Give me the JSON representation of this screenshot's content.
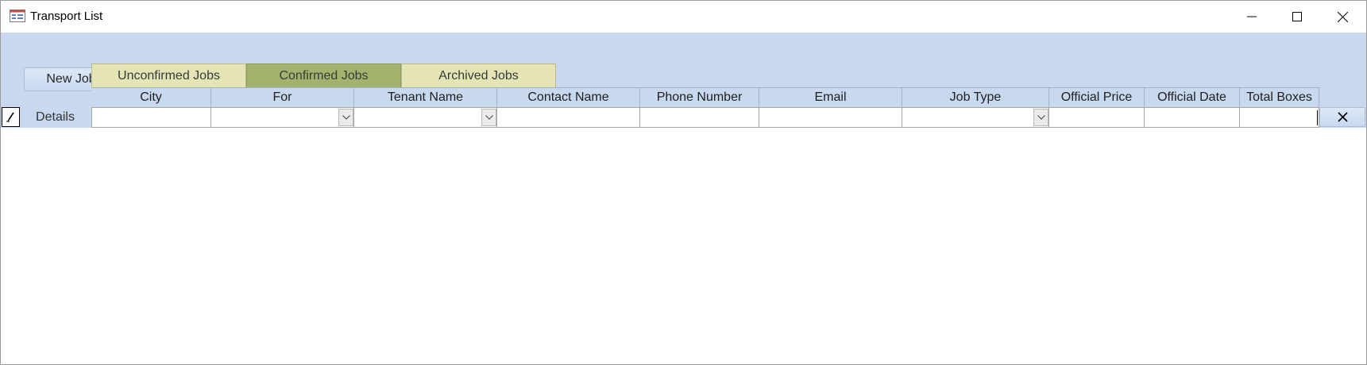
{
  "window": {
    "title": "Transport List"
  },
  "header": {
    "new_job_label": "New Job"
  },
  "tabs": [
    {
      "label": "Unconfirmed Jobs",
      "active": false
    },
    {
      "label": "Confirmed Jobs",
      "active": true
    },
    {
      "label": "Archived Jobs",
      "active": false
    }
  ],
  "columns": [
    "City",
    "For",
    "Tenant Name",
    "Contact Name",
    "Phone Number",
    "Email",
    "Job Type",
    "Official Price",
    "Official Date",
    "Total Boxes"
  ],
  "row": {
    "details_label": "Details",
    "values": [
      "",
      "",
      "",
      "",
      "",
      "",
      "",
      "",
      "",
      ""
    ],
    "selector_icon": "pencil-icon",
    "delete_icon": "close-icon"
  },
  "colors": {
    "header_bg": "#c8d8ef",
    "tab_bg": "#e4e4b4",
    "tab_active_bg": "#a3b36e"
  }
}
